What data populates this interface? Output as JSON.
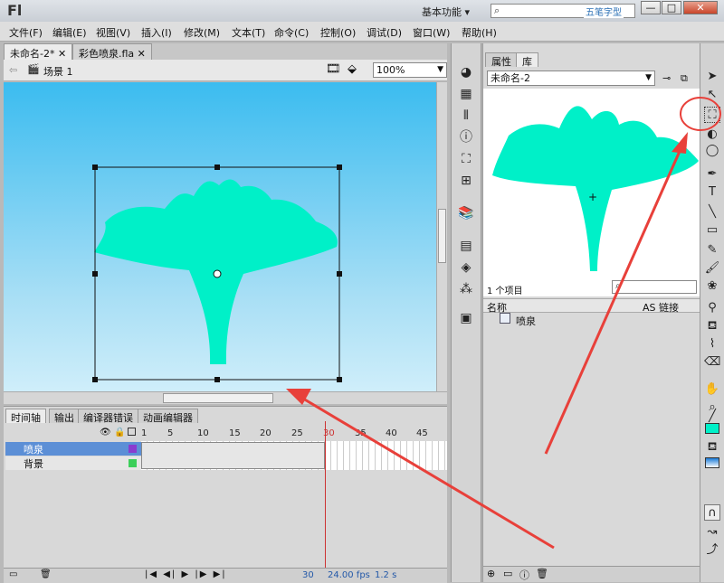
{
  "app": {
    "logo": "Fl",
    "workspace": "基本功能 ▾",
    "watermark": "五笔字型"
  },
  "window_controls": {
    "minimize": "—",
    "maximize": "□",
    "close": "✕"
  },
  "menu": [
    "文件(F)",
    "编辑(E)",
    "视图(V)",
    "插入(I)",
    "修改(M)",
    "文本(T)",
    "命令(C)",
    "控制(O)",
    "调试(D)",
    "窗口(W)",
    "帮助(H)"
  ],
  "document_tabs": [
    {
      "label": "未命名-2*",
      "close": "✕"
    },
    {
      "label": "彩色喷泉.fla",
      "close": "✕"
    }
  ],
  "scene": {
    "label": "场景 1",
    "zoom": "100%"
  },
  "timeline": {
    "tabs": [
      "时间轴",
      "输出",
      "编译器错误",
      "动画编辑器"
    ],
    "frame_numbers": [
      "1",
      "5",
      "10",
      "15",
      "20",
      "25",
      "30",
      "35",
      "40",
      "45"
    ],
    "layers": [
      {
        "name": "喷泉"
      },
      {
        "name": "背景"
      }
    ],
    "status": {
      "frame": "30",
      "fps": "24.00 fps",
      "time": "1.2 s"
    }
  },
  "library": {
    "tabs": [
      "属性",
      "库"
    ],
    "document": "未命名-2",
    "item_count": "1 个项目",
    "columns": {
      "name": "名称",
      "linkage": "AS 链接"
    },
    "items": [
      {
        "name": "喷泉"
      }
    ]
  },
  "colors": {
    "shape": "#00f0c8",
    "stage_top": "#3bbcf0",
    "annotation": "#e8403a",
    "layer_selected": "#5c8fd6"
  }
}
